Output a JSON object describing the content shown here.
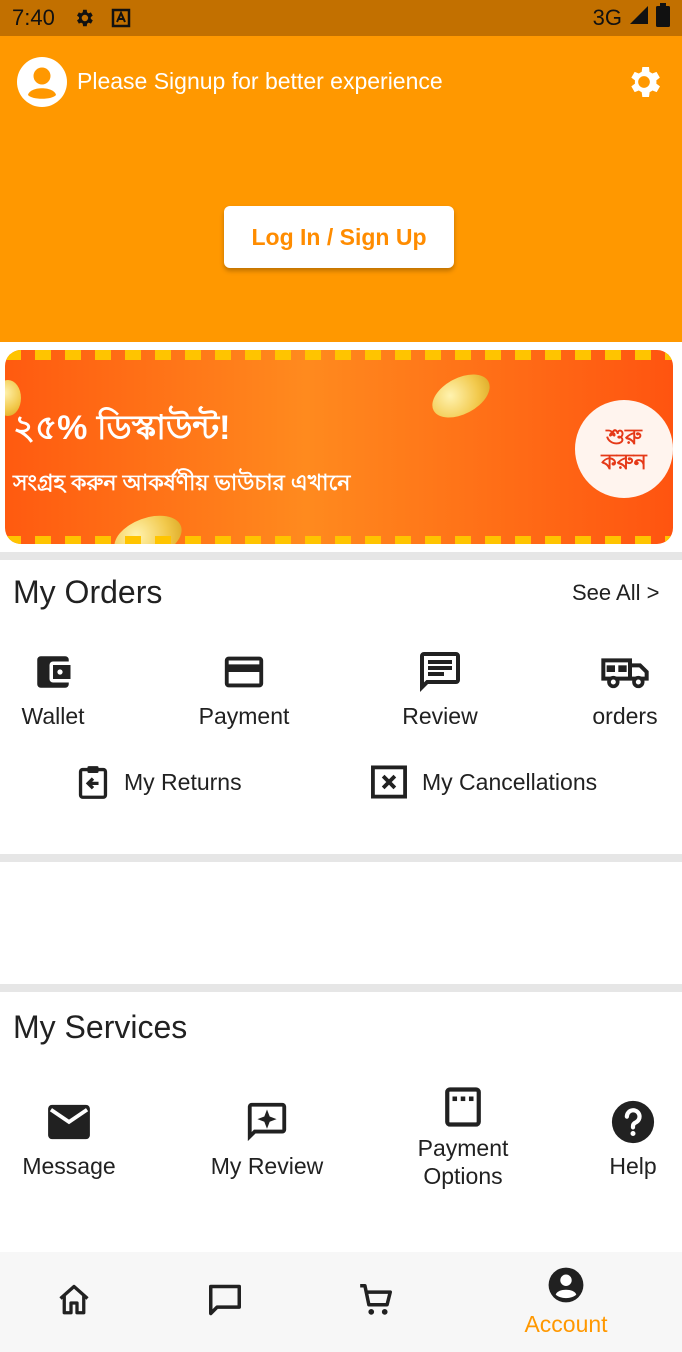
{
  "status_bar": {
    "time": "7:40",
    "network": "3G"
  },
  "header": {
    "signup_prompt": "Please Signup for better experience",
    "login_button": "Log In / Sign Up"
  },
  "banner": {
    "headline": "২৫% ডিস্কাউন্ট!",
    "subline": "সংগ্রহ করুন আকর্ষণীয় ভাউচার এখানে",
    "cta": "শুরু করুন"
  },
  "orders": {
    "title": "My Orders",
    "see_all": "See All >",
    "items": [
      {
        "label": "Wallet",
        "icon": "wallet-icon"
      },
      {
        "label": "Payment",
        "icon": "credit-card-icon"
      },
      {
        "label": "Review",
        "icon": "review-icon"
      },
      {
        "label": "orders",
        "icon": "truck-icon"
      }
    ],
    "row2": [
      {
        "label": "My Returns",
        "icon": "return-icon"
      },
      {
        "label": "My Cancellations",
        "icon": "cancel-icon"
      }
    ]
  },
  "services": {
    "title": "My Services",
    "items": [
      {
        "label": "Message",
        "icon": "mail-icon"
      },
      {
        "label": "My Review",
        "icon": "star-chat-icon"
      },
      {
        "label": "Payment Options",
        "icon": "payment-options-icon"
      },
      {
        "label": "Help",
        "icon": "help-icon"
      }
    ]
  },
  "bottom_nav": {
    "items": [
      {
        "icon": "home-icon"
      },
      {
        "icon": "chat-icon"
      },
      {
        "icon": "cart-icon"
      },
      {
        "icon": "account-icon",
        "label": "Account",
        "active": true
      }
    ],
    "active_color": "#ff9800"
  },
  "colors": {
    "primary": "#ff9800",
    "status_bar": "#c27000",
    "text": "#212121"
  }
}
